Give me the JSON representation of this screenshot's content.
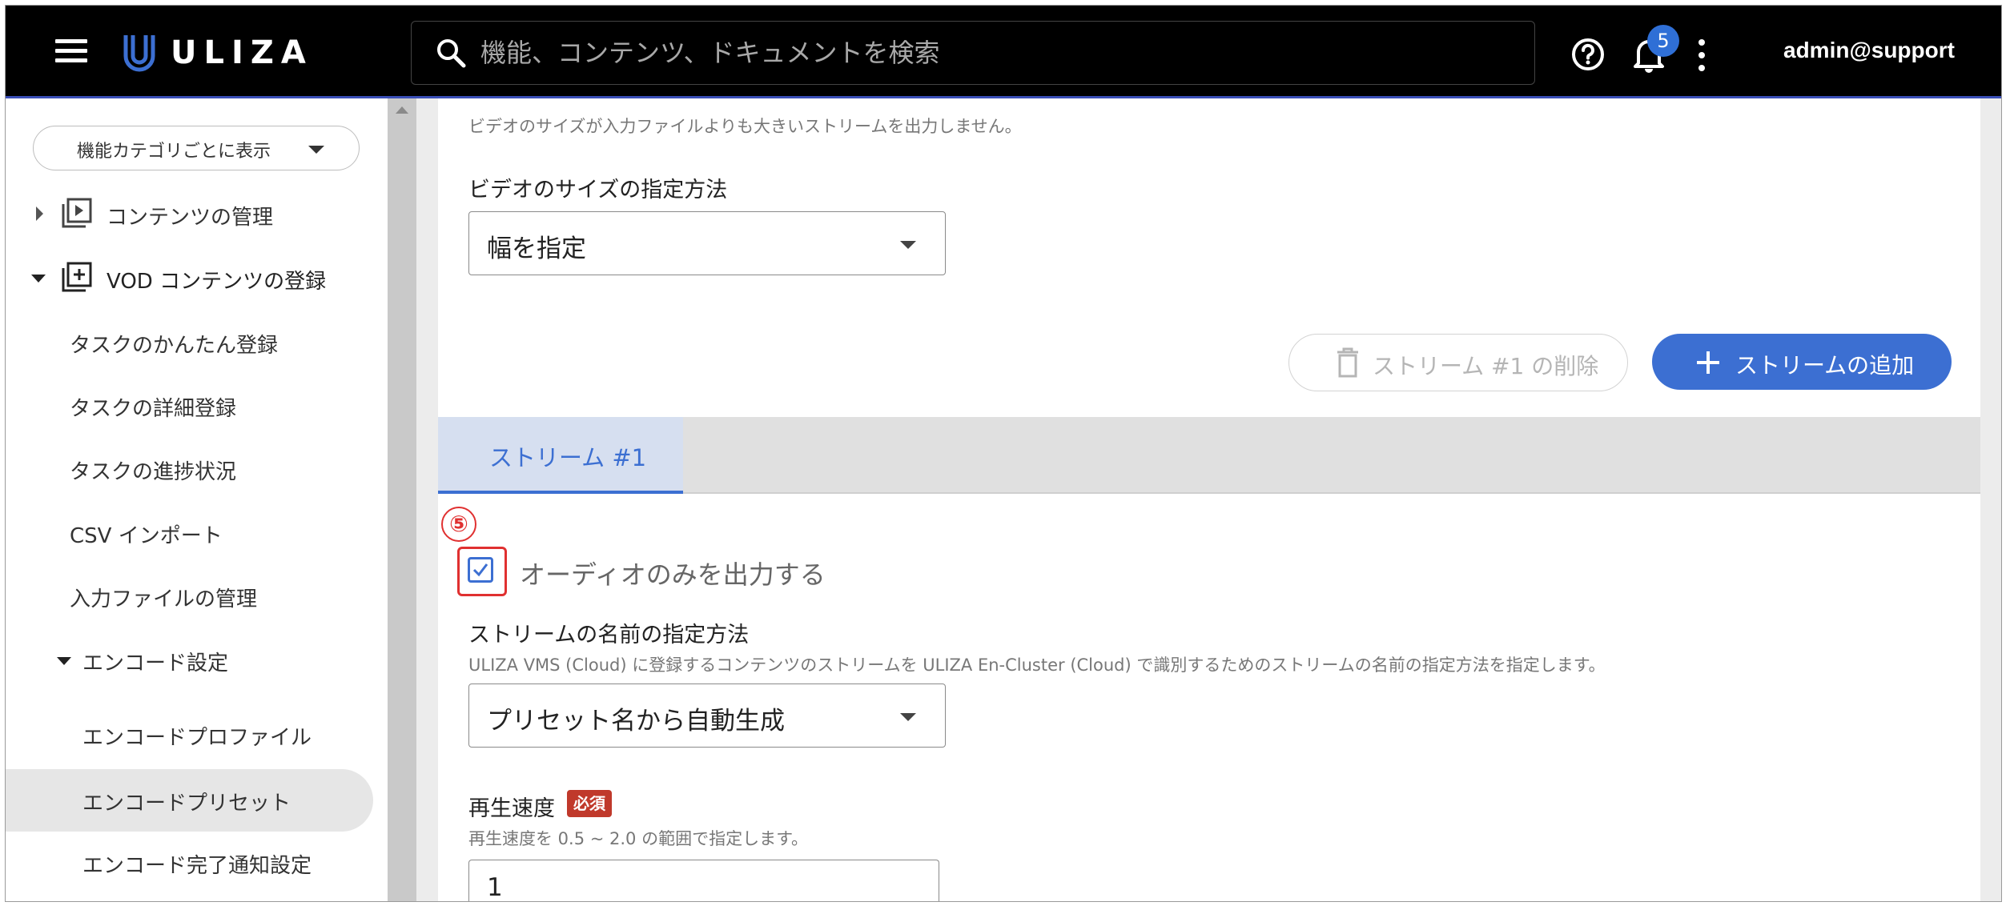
{
  "header": {
    "logo_text": "ULIZA",
    "search_placeholder": "機能、コンテンツ、ドキュメントを検索",
    "notification_count": "5",
    "user": "admin@support",
    "icons": [
      "menu-icon",
      "search-icon",
      "help-icon",
      "bell-icon",
      "kebab-icon"
    ]
  },
  "sidebar": {
    "category_select": "機能カテゴリごとに表示",
    "items": [
      {
        "label": "コンテンツの管理",
        "expanded": false
      },
      {
        "label": "VOD コンテンツの登録",
        "expanded": true
      },
      {
        "label": "タスクのかんたん登録"
      },
      {
        "label": "タスクの詳細登録"
      },
      {
        "label": "タスクの進捗状況"
      },
      {
        "label": "CSV インポート"
      },
      {
        "label": "入力ファイルの管理"
      },
      {
        "label": "エンコード設定",
        "expanded": true
      },
      {
        "label": "エンコードプロファイル"
      },
      {
        "label": "エンコードプリセット",
        "selected": true
      },
      {
        "label": "エンコード完了通知設定"
      }
    ]
  },
  "main": {
    "top_help": "ビデオのサイズが入力ファイルよりも大きいストリームを出力しません。",
    "video_size": {
      "label": "ビデオのサイズの指定方法",
      "value": "幅を指定"
    },
    "delete_button": "ストリーム #1 の削除",
    "add_button": "ストリームの追加",
    "tabs": [
      {
        "label": "ストリーム #1",
        "active": true
      }
    ],
    "annotation_number": "⑤",
    "audio_only": {
      "label": "オーディオのみを出力する",
      "checked": true
    },
    "stream_name": {
      "label": "ストリームの名前の指定方法",
      "help": "ULIZA VMS (Cloud) に登録するコンテンツのストリームを ULIZA En-Cluster (Cloud) で識別するためのストリームの名前の指定方法を指定します。",
      "value": "プリセット名から自動生成"
    },
    "playback_speed": {
      "label": "再生速度",
      "required_badge": "必須",
      "help": "再生速度を 0.5 ~ 2.0 の範囲で指定します。",
      "value": "1"
    }
  },
  "colors": {
    "accent": "#3c6fd2",
    "header_bg": "#000000",
    "annotation": "#e03030",
    "required": "#c0392b"
  }
}
